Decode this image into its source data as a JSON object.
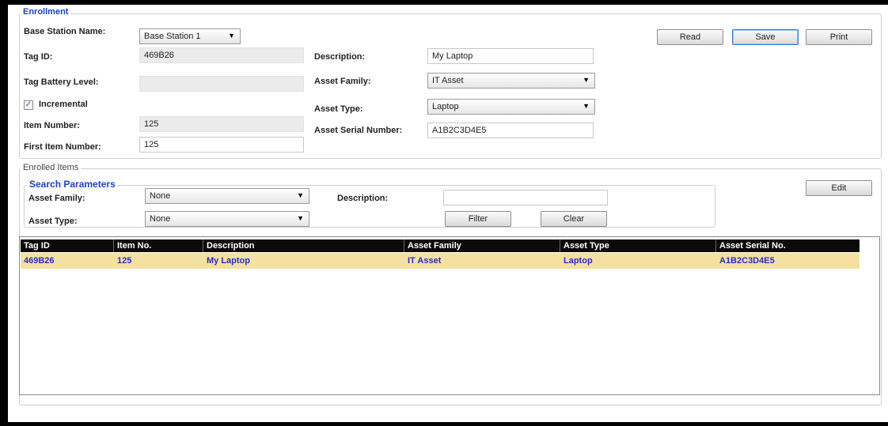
{
  "enrollment": {
    "legend": "Enrollment",
    "base_station_label": "Base Station Name:",
    "base_station_value": "Base Station 1",
    "tag_id_label": "Tag ID:",
    "tag_id_value": "469B26",
    "tag_battery_label": "Tag Battery Level:",
    "tag_battery_value": "",
    "incremental_label": "Incremental",
    "incremental_checked": true,
    "item_number_label": "Item Number:",
    "item_number_value": "125",
    "first_item_label": "First Item Number:",
    "first_item_value": "125",
    "description_label": "Description:",
    "description_value": "My Laptop",
    "asset_family_label": "Asset Family:",
    "asset_family_value": "IT Asset",
    "asset_type_label": "Asset Type:",
    "asset_type_value": "Laptop",
    "asset_serial_label": "Asset Serial Number:",
    "asset_serial_value": "A1B2C3D4E5",
    "read_button": "Read",
    "save_button": "Save",
    "print_button": "Print"
  },
  "enrolled_items": {
    "legend": "Enrolled Items",
    "edit_button": "Edit",
    "search": {
      "legend": "Search Parameters",
      "asset_family_label": "Asset Family:",
      "asset_family_value": "None",
      "asset_type_label": "Asset Type:",
      "asset_type_value": "None",
      "description_label": "Description:",
      "description_value": "",
      "filter_button": "Filter",
      "clear_button": "Clear"
    },
    "table": {
      "columns": [
        "Tag ID",
        "Item No.",
        "Description",
        "Asset Family",
        "Asset Type",
        "Asset Serial No."
      ],
      "rows": [
        [
          "469B26",
          "125",
          "My Laptop",
          "IT Asset",
          "Laptop",
          "A1B2C3D4E5"
        ]
      ],
      "selected_row_color": "#f4e1a1",
      "header_color": "#0b0b0b",
      "cell_text_color": "#2a2ad0"
    }
  },
  "colors": {
    "legend_blue": "#1f3fd0",
    "frame": "#000000"
  }
}
